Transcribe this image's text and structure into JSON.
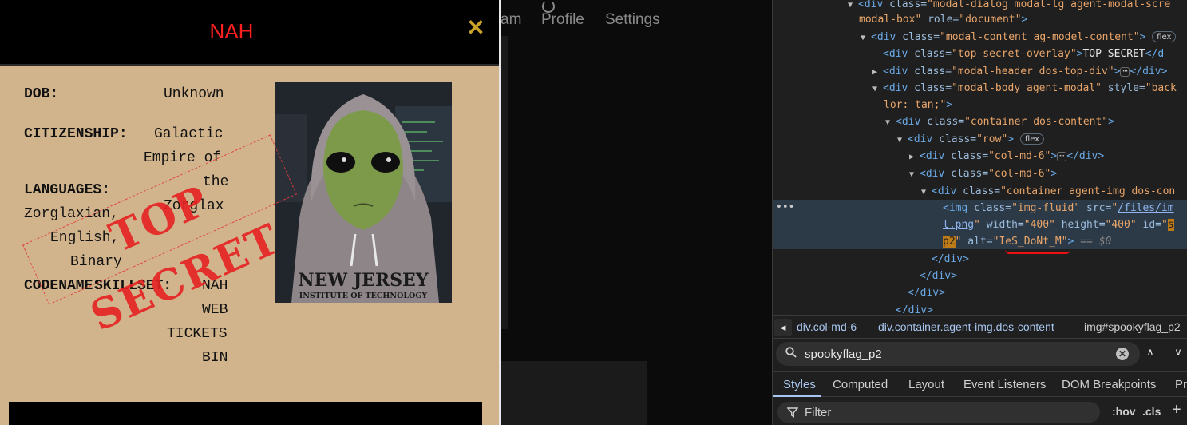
{
  "modal": {
    "title": "NAH",
    "close_glyph": "✕",
    "dob_label": "DOB:",
    "dob_value": "Unknown",
    "citizenship_label": "CITIZENSHIP:",
    "citizenship_lines": [
      "Galactic",
      "Empire of",
      "the",
      "Zorglax"
    ],
    "languages_label": "LANGUAGES:",
    "languages_lines": [
      "Zorglaxian,",
      "English,",
      "Binary"
    ],
    "codename_label": "CODENAME:",
    "skillset_label": "SKILLSET:",
    "codename_value": "NAH",
    "skillset_lines": [
      "WEB",
      "TICKETS",
      "BIN"
    ],
    "stamp_text": "TOP SECRET",
    "avatar_hoodie_line1": "NEW JERSEY",
    "avatar_hoodie_line2": "INSTITUTE OF TECHNOLOGY"
  },
  "background_nav": {
    "partial_item": "am",
    "profile": "Profile",
    "settings": "Settings"
  },
  "devtools": {
    "tree": {
      "l0": {
        "open": "<div ",
        "class_attr": "class=",
        "class_val": "\"modal-dialog modal-lg agent-modal-scre"
      },
      "l1": {
        "text": "modal-box\"",
        "attr": " role=",
        "val": "\"document\"",
        "end": ">"
      },
      "l2": {
        "open": "<div ",
        "attr": "class=",
        "val": "\"modal-content ag-model-content\"",
        "end": ">",
        "pill": "flex"
      },
      "l3": {
        "open": "<div ",
        "attr": "class=",
        "val": "\"top-secret-overlay\"",
        "mid": ">",
        "text": "TOP SECRET",
        "close": "</d"
      },
      "l4": {
        "open": "<div ",
        "attr": "class=",
        "val": "\"modal-header dos-top-div\"",
        "mid": ">",
        "ellipsis": "⋯",
        "close": "</div>"
      },
      "l5": {
        "open": "<div ",
        "attr": "class=",
        "val": "\"modal-body agent-modal\"",
        "attr2": " style=",
        "val2": "\"back"
      },
      "l6": {
        "val": "lor: tan;\"",
        "end": ">"
      },
      "l7": {
        "open": "<div ",
        "attr": "class=",
        "val": "\"container dos-content\"",
        "end": ">"
      },
      "l8": {
        "open": "<div ",
        "attr": "class=",
        "val": "\"row\"",
        "end": ">",
        "pill": "flex"
      },
      "l9": {
        "open": "<div ",
        "attr": "class=",
        "val": "\"col-md-6\"",
        "mid": ">",
        "ellipsis": "⋯",
        "close": "</div>"
      },
      "l10": {
        "open": "<div ",
        "attr": "class=",
        "val": "\"col-md-6\"",
        "end": ">"
      },
      "l11": {
        "open": "<div ",
        "attr": "class=",
        "val": "\"container agent-img dos-con"
      },
      "l12": {
        "open": "<img ",
        "attr": "class=",
        "val": "\"img-fluid\"",
        "attr2": " src=",
        "q": "\"",
        "link": "/files/im"
      },
      "l13": {
        "link": "l.png",
        "q": "\"",
        "attr": " width=",
        "val": "\"400\"",
        "attr2": " height=",
        "val2": "\"400\"",
        "attr3": " id=",
        "q2": "\"",
        "mark": "s"
      },
      "l14": {
        "mark": "p2",
        "q": "\"",
        "attr": " alt=",
        "val": "\"IeS_DoNt_M\"",
        "end": ">",
        "eq": " == ",
        "ref": "$0"
      },
      "l15": {
        "close": "</div>"
      },
      "l16": {
        "close": "</div>"
      },
      "l17": {
        "close": "</div>"
      },
      "l18": {
        "close": "</div>"
      }
    },
    "gutter_dots": "•••",
    "breadcrumbs": {
      "back": "◀",
      "c1": "div.col-md-6",
      "c2": "div.container.agent-img.dos-content",
      "c3_tag": "img",
      "c3_id": "#spookyflag_p2"
    },
    "search_value": "spookyflag_p2",
    "search_clear": "✕",
    "search_prev": "∧",
    "search_next": "∨",
    "tabs": [
      "Styles",
      "Computed",
      "Layout",
      "Event Listeners",
      "DOM Breakpoints",
      "Pro"
    ],
    "filter_placeholder": "Filter",
    "hov": ":hov",
    "cls": ".cls",
    "plus": "+"
  }
}
